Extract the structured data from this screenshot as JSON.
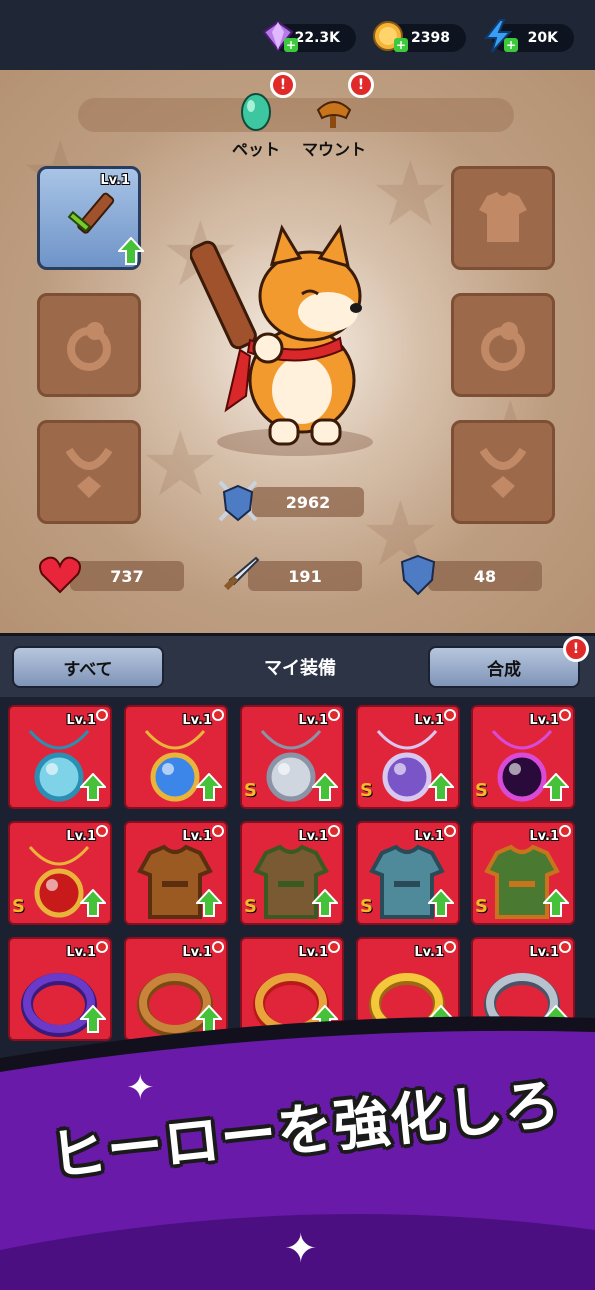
{
  "resources": {
    "gems": "22.3K",
    "coins": "2398",
    "energy": "20K"
  },
  "companions": {
    "pet_label": "ペット",
    "mount_label": "マウント",
    "alert_mark": "!"
  },
  "weapon_slot": {
    "level": "Lv.1"
  },
  "power": "2962",
  "stats": {
    "hp": "737",
    "attack": "191",
    "defense": "48"
  },
  "panel": {
    "all_label": "すべて",
    "title": "マイ装備",
    "merge_label": "合成",
    "merge_alert": "!"
  },
  "equipment": [
    {
      "level": "Lv.1",
      "rank": "",
      "item": "water-amulet"
    },
    {
      "level": "Lv.1",
      "rank": "",
      "item": "sapphire-amulet"
    },
    {
      "level": "Lv.1",
      "rank": "S",
      "item": "silver-chain-necklace"
    },
    {
      "level": "Lv.1",
      "rank": "S",
      "item": "crystal-pendant"
    },
    {
      "level": "Lv.1",
      "rank": "S",
      "item": "void-orb-necklace"
    },
    {
      "level": "Lv.1",
      "rank": "S",
      "item": "ruby-necklace"
    },
    {
      "level": "Lv.1",
      "rank": "",
      "item": "leather-vest"
    },
    {
      "level": "Lv.1",
      "rank": "S",
      "item": "leather-armor"
    },
    {
      "level": "Lv.1",
      "rank": "S",
      "item": "steel-armor"
    },
    {
      "level": "Lv.1",
      "rank": "S",
      "item": "jungle-armor"
    },
    {
      "level": "Lv.1",
      "rank": "",
      "item": "purple-ring"
    },
    {
      "level": "Lv.1",
      "rank": "",
      "item": "bronze-ring"
    },
    {
      "level": "Lv.1",
      "rank": "",
      "item": "ruby-ring"
    },
    {
      "level": "Lv.1",
      "rank": "",
      "item": "gold-ring"
    },
    {
      "level": "Lv.1",
      "rank": "",
      "item": "silver-ring"
    }
  ],
  "banner": {
    "headline": "ヒーローを強化しろ"
  },
  "colors": {
    "card_red": "#e0253b",
    "upgrade_green": "#46c13a",
    "alert_red": "#e02a2a",
    "banner_purple": "#6a1aa8"
  }
}
